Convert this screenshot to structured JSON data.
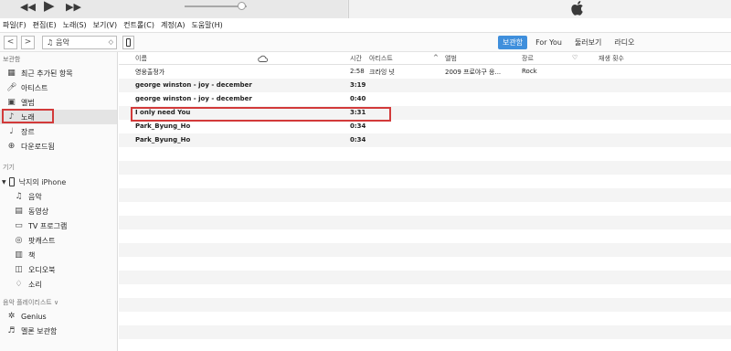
{
  "player": {
    "icons": [
      "rewind-icon",
      "play-icon",
      "fast-forward-icon",
      "volume-slider",
      "apple-logo"
    ],
    "volume_level": 0.85
  },
  "menu": [
    "파일(F)",
    "편집(E)",
    "노래(S)",
    "보기(V)",
    "컨트롤(C)",
    "계정(A)",
    "도움말(H)"
  ],
  "toolbar": {
    "back": "<",
    "forward": ">",
    "media_label": "음악",
    "tabs": [
      "보관함",
      "For You",
      "둘러보기",
      "라디오"
    ],
    "active_tab": "보관함",
    "accent": "#3f8fdc"
  },
  "sidebar": {
    "library_header": "보관함",
    "library_items": [
      {
        "label": "최근 추가된 항목",
        "icon": "recent-grid-icon"
      },
      {
        "label": "아티스트",
        "icon": "microphone-icon"
      },
      {
        "label": "앨범",
        "icon": "album-icon"
      },
      {
        "label": "노래",
        "icon": "music-note-icon"
      },
      {
        "label": "장르",
        "icon": "genre-icon"
      },
      {
        "label": "다운로드됨",
        "icon": "download-icon"
      }
    ],
    "devices_header": "기기",
    "device_name": "낙지의 iPhone",
    "device_items": [
      {
        "label": "음악",
        "icon": "music-note-icon"
      },
      {
        "label": "동영상",
        "icon": "film-icon"
      },
      {
        "label": "TV 프로그램",
        "icon": "tv-icon"
      },
      {
        "label": "팟캐스트",
        "icon": "podcast-icon"
      },
      {
        "label": "책",
        "icon": "book-icon"
      },
      {
        "label": "오디오북",
        "icon": "audiobook-icon"
      },
      {
        "label": "소리",
        "icon": "bell-icon"
      }
    ],
    "playlists_header": "음악 플레이리스트 ∨",
    "playlist_items": [
      {
        "label": "Genius",
        "icon": "genius-atom-icon"
      },
      {
        "label": "멜론 보관함",
        "icon": "playlist-icon"
      }
    ],
    "highlight_color": "#d23a3a"
  },
  "table": {
    "columns": {
      "name": "이름",
      "cloud": "cloud-icon",
      "time": "시간",
      "artist": "아티스트",
      "album": "앨범",
      "genre": "장르",
      "love": "heart-icon",
      "plays": "재생 횟수"
    },
    "sort_arrow": "^",
    "rows": [
      {
        "name": "영웅출정가",
        "time": "2:58",
        "artist": "크라잉 넛",
        "album": "2009 프로야구 응...",
        "genre": "Rock"
      },
      {
        "name": "george winston - joy - december",
        "time": "3:19",
        "artist": "",
        "album": "",
        "genre": ""
      },
      {
        "name": "george winston - joy - december",
        "time": "0:40",
        "artist": "",
        "album": "",
        "genre": ""
      },
      {
        "name": "I only need You",
        "time": "3:31",
        "artist": "",
        "album": "",
        "genre": ""
      },
      {
        "name": "Park_Byung_Ho",
        "time": "0:34",
        "artist": "",
        "album": "",
        "genre": ""
      },
      {
        "name": "Park_Byung_Ho",
        "time": "0:34",
        "artist": "",
        "album": "",
        "genre": ""
      }
    ],
    "highlighted_row": 3
  }
}
